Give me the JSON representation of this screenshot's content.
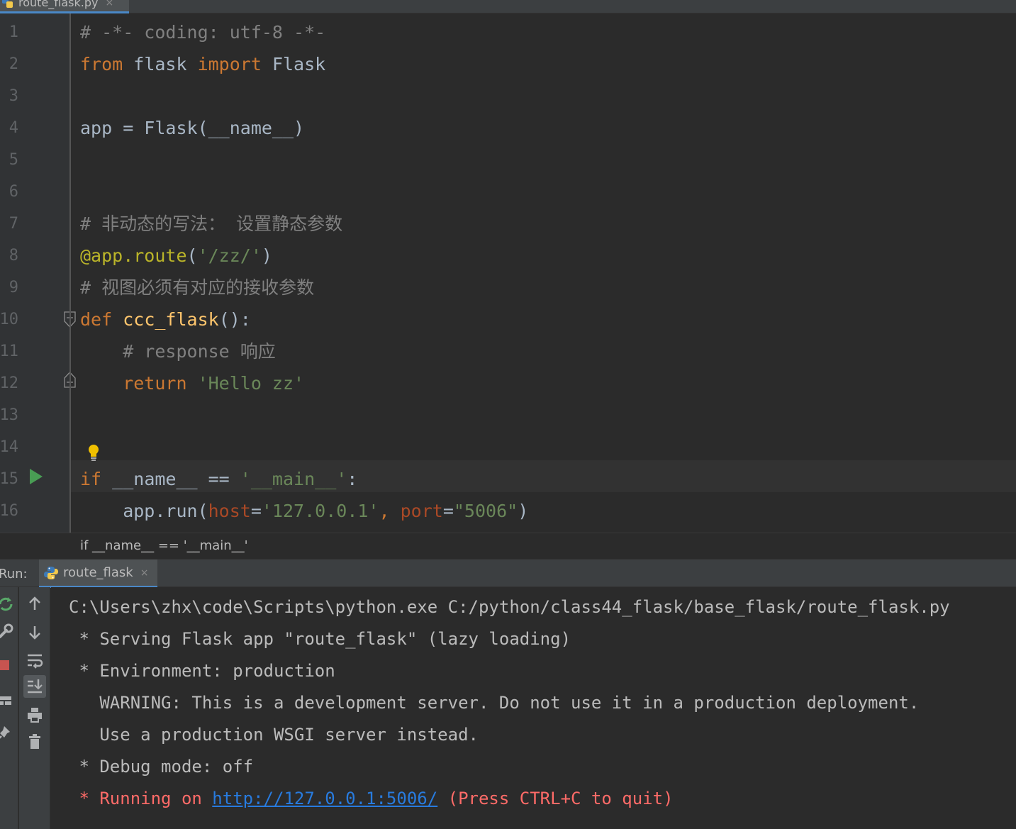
{
  "editor_tab": {
    "file_name": "route_flask.py",
    "close_glyph": "×"
  },
  "line_numbers": [
    "1",
    "2",
    "3",
    "4",
    "5",
    "6",
    "7",
    "8",
    "9",
    "10",
    "11",
    "12",
    "13",
    "14",
    "15",
    "16"
  ],
  "code": {
    "l1": "# -*- coding: utf-8 -*-",
    "l2_kw1": "from",
    "l2_mid": " flask ",
    "l2_kw2": "import",
    "l2_end": " Flask",
    "l4": "app = Flask(__name__)",
    "l7": "# 非动态的写法： 设置静态参数",
    "l8_deco": "@app.route",
    "l8_open": "(",
    "l8_str": "'/zz/'",
    "l8_close": ")",
    "l9": "# 视图必须有对应的接收参数",
    "l10_kw": "def",
    "l10_fn": "ccc_flask",
    "l10_end": "():",
    "l11": "    # response 响应",
    "l12_kw": "    return",
    "l12_str": " 'Hello zz'",
    "l15_kw": "if",
    "l15_mid": " __name__ == ",
    "l15_str": "'__main__'",
    "l15_end": ":",
    "l16_a": "    app.run(",
    "l16_p1": "host",
    "l16_eq1": "=",
    "l16_s1": "'127.0.0.1'",
    "l16_c": ", ",
    "l16_p2": "port",
    "l16_eq2": "=",
    "l16_s2": "\"5006\"",
    "l16_end": ")"
  },
  "breadcrumb": "if __name__ == '__main__'",
  "run_panel": {
    "label": "Run:",
    "tab_name": "route_flask",
    "close_glyph": "×",
    "console": {
      "c1": "C:\\Users\\zhx\\code\\Scripts\\python.exe C:/python/class44_flask/base_flask/route_flask.py",
      "c2": " * Serving Flask app \"route_flask\" (lazy loading)",
      "c3": " * Environment: production",
      "c4": "   WARNING: This is a development server. Do not use it in a production deployment.",
      "c5": "   Use a production WSGI server instead.",
      "c6": " * Debug mode: off",
      "c7_a": " * Running on ",
      "c7_link": "http://127.0.0.1:5006/",
      "c7_b": " (Press CTRL+C to quit)"
    }
  },
  "colors": {
    "editor_bg": "#2b2b2b",
    "keyword": "#cc7832",
    "string": "#6a8759",
    "comment": "#808080",
    "decorator": "#bbb529",
    "function": "#ffc66d",
    "param": "#aa4926",
    "console_red": "#ff6b68",
    "link": "#287bde"
  }
}
